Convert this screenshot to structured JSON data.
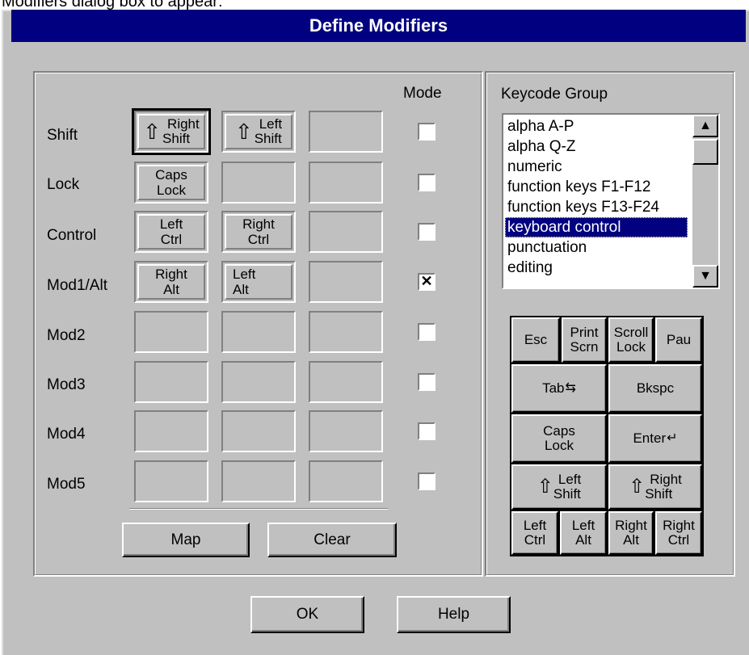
{
  "caption": "Modifiers dialog box to appear:",
  "dialog": {
    "title": "Define Modifiers"
  },
  "modifiers": {
    "mode_label": "Mode",
    "rows": [
      {
        "label": "Shift",
        "mode": ""
      },
      {
        "label": "Lock",
        "mode": ""
      },
      {
        "label": "Control",
        "mode": ""
      },
      {
        "label": "Mod1/Alt",
        "mode": "✕"
      },
      {
        "label": "Mod2",
        "mode": ""
      },
      {
        "label": "Mod3",
        "mode": ""
      },
      {
        "label": "Mod4",
        "mode": ""
      },
      {
        "label": "Mod5",
        "mode": ""
      }
    ],
    "assigned": {
      "shift_1": {
        "l1": "Right",
        "l2": "Shift"
      },
      "shift_2": {
        "l1": "Left",
        "l2": "Shift"
      },
      "lock_1": {
        "l1": "Caps",
        "l2": "Lock"
      },
      "control_1": {
        "l1": "Left",
        "l2": "Ctrl"
      },
      "control_2": {
        "l1": "Right",
        "l2": "Ctrl"
      },
      "mod1_1": {
        "l1": "Right",
        "l2": "Alt"
      },
      "mod1_2": {
        "l1": "Left",
        "l2": "Alt"
      }
    },
    "map_button": "Map",
    "clear_button": "Clear"
  },
  "keycode_group": {
    "label": "Keycode Group",
    "items": [
      "alpha A-P",
      "alpha Q-Z",
      "numeric",
      "function keys F1-F12",
      "function keys F13-F24",
      "keyboard control",
      "punctuation",
      "editing"
    ],
    "selected": "keyboard control"
  },
  "keypad": {
    "esc": "Esc",
    "print_1": "Print",
    "print_2": "Scrn",
    "scroll_1": "Scroll",
    "scroll_2": "Lock",
    "pause": "Pau",
    "tab": "Tab",
    "bkspc": "Bkspc",
    "caps_1": "Caps",
    "caps_2": "Lock",
    "enter": "Enter",
    "lshift_1": "Left",
    "lshift_2": "Shift",
    "rshift_1": "Right",
    "rshift_2": "Shift",
    "lctrl_1": "Left",
    "lctrl_2": "Ctrl",
    "lalt_1": "Left",
    "lalt_2": "Alt",
    "ralt_1": "Right",
    "ralt_2": "Alt",
    "rctrl_1": "Right",
    "rctrl_2": "Ctrl"
  },
  "buttons": {
    "ok": "OK",
    "help": "Help"
  }
}
